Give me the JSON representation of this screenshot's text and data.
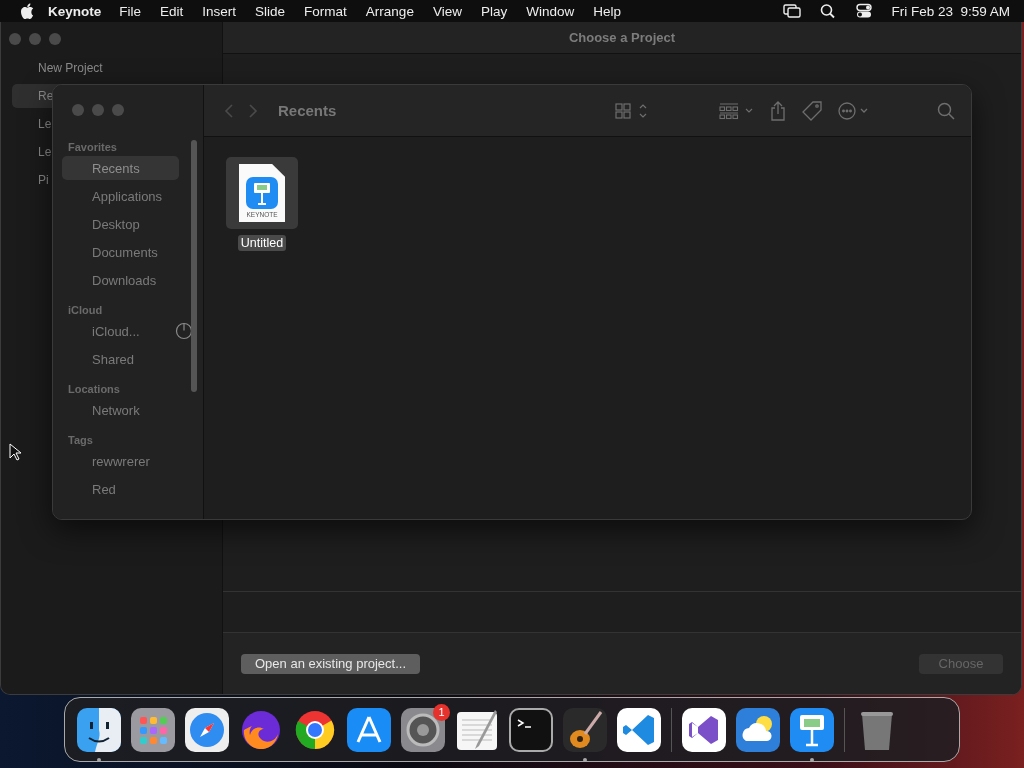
{
  "menu_bar": {
    "app_name": "Keynote",
    "menus": [
      "File",
      "Edit",
      "Insert",
      "Slide",
      "Format",
      "Arrange",
      "View",
      "Play",
      "Window",
      "Help"
    ],
    "clock": "Fri Feb 23  9:59 AM"
  },
  "project_window": {
    "title": "Choose a Project",
    "sidebar": [
      {
        "label": "New Project",
        "selected": false
      },
      {
        "label": "Re",
        "selected": true
      },
      {
        "label": "Le",
        "selected": false
      },
      {
        "label": "Le",
        "selected": false
      },
      {
        "label": "Pi",
        "selected": false
      }
    ],
    "open_button": "Open an existing project...",
    "choose_button": {
      "label": "Choose",
      "disabled": true
    }
  },
  "finder_dialog": {
    "location": "Recents",
    "sidebar": [
      {
        "heading": "Favorites",
        "items": [
          {
            "label": "Recents",
            "selected": true
          },
          {
            "label": "Applications",
            "selected": false
          },
          {
            "label": "Desktop",
            "selected": false
          },
          {
            "label": "Documents",
            "selected": false
          },
          {
            "label": "Downloads",
            "selected": false
          }
        ]
      },
      {
        "heading": "iCloud",
        "items": [
          {
            "label": "iCloud...",
            "selected": false,
            "syncing": true
          },
          {
            "label": "Shared",
            "selected": false
          }
        ]
      },
      {
        "heading": "Locations",
        "items": [
          {
            "label": "Network",
            "selected": false
          }
        ]
      },
      {
        "heading": "Tags",
        "items": [
          {
            "label": "rewwrerer",
            "selected": false
          },
          {
            "label": "Red",
            "selected": false
          }
        ]
      }
    ],
    "files": [
      {
        "name": "Untitled",
        "badge": "KEYNOTE",
        "selected": true
      }
    ]
  },
  "dock": {
    "items": [
      {
        "running": true
      },
      {
        "running": false
      },
      {
        "running": false
      },
      {
        "running": false
      },
      {
        "running": false
      },
      {
        "running": false
      },
      {
        "running": false,
        "badge": "1"
      },
      {
        "running": false
      },
      {
        "running": false
      },
      {
        "running": true
      },
      {
        "running": false
      },
      {
        "running": false
      },
      {
        "running": false
      },
      {
        "running": true
      },
      {
        "running": false
      }
    ]
  }
}
